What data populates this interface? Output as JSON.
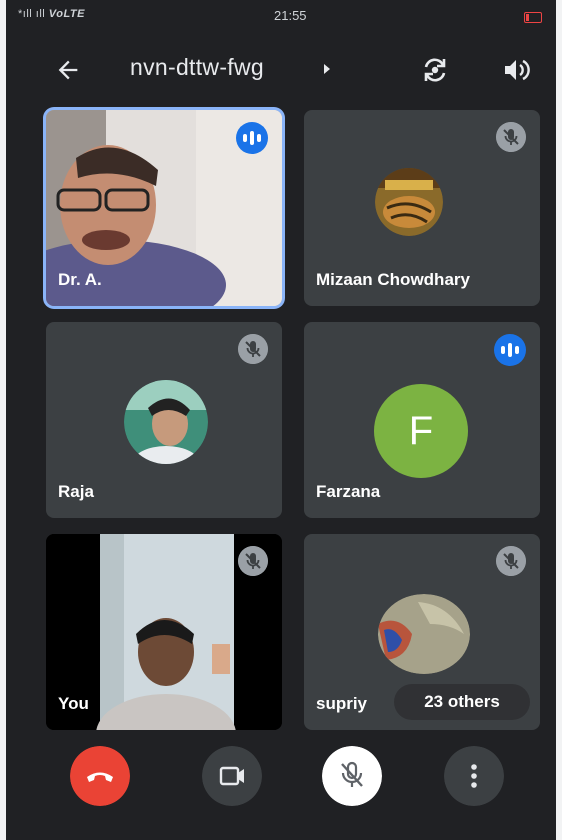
{
  "status_bar": {
    "signal": "*",
    "signal_text": "ıll ıll",
    "network": "VoLTE",
    "time": "21:55"
  },
  "app_bar": {
    "meeting_code": "nvn-dttw-fwg"
  },
  "participants": [
    {
      "name": "Dr. A.",
      "state": "speaking"
    },
    {
      "name": "Mizaan Chowdhary",
      "state": "muted"
    },
    {
      "name": "Raja",
      "state": "muted"
    },
    {
      "name": "Farzana",
      "state": "speaking",
      "initial": "F"
    },
    {
      "name": "You",
      "state": "muted"
    },
    {
      "name": "supriy",
      "state": "muted"
    }
  ],
  "others_chip": {
    "label": "23 others"
  },
  "controls": {
    "colors": {
      "end_call": "#ea4335",
      "speaking": "#1a73e8",
      "farzana_avatar": "#7cb342"
    }
  }
}
